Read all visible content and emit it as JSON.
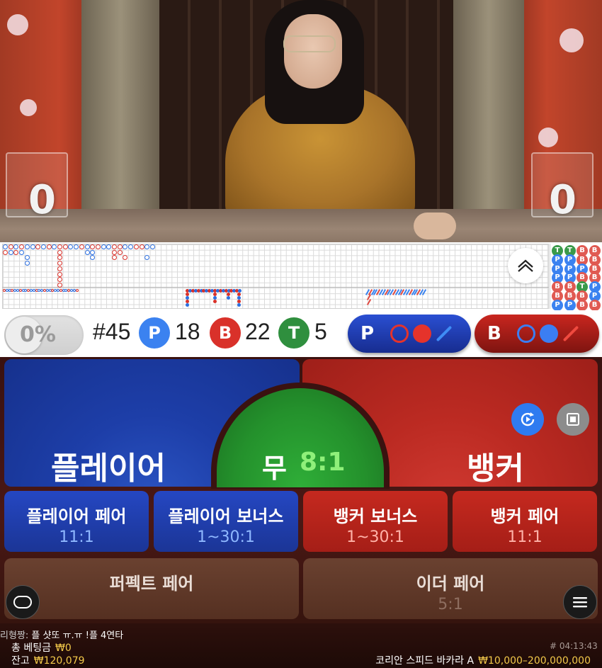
{
  "video": {
    "score_player": "0",
    "score_banker": "0"
  },
  "roadmap": {
    "expand_icon": "chevron-up-icon",
    "bead_columns": [
      [
        "T",
        "P",
        "P",
        "P",
        "B",
        "B",
        "P"
      ],
      [
        "T",
        "P",
        "P",
        "P",
        "B",
        "B",
        "P"
      ],
      [
        "B",
        "B",
        "P",
        "B",
        "T",
        "B",
        "B"
      ],
      [
        "B",
        "B",
        "B",
        "B",
        "P",
        "P",
        "B"
      ]
    ]
  },
  "stats": {
    "percent": "0%",
    "round_number": "#45",
    "player_letter": "P",
    "player_count": "18",
    "banker_letter": "B",
    "banker_count": "22",
    "tie_letter": "T",
    "tie_count": "5",
    "player_predict_label": "P",
    "banker_predict_label": "B"
  },
  "bets": {
    "player": "플레이어",
    "banker": "뱅커",
    "tie": "무",
    "tie_odds": "8:1",
    "player_pair": {
      "label": "플레이어 페어",
      "odds": "11:1"
    },
    "player_bonus": {
      "label": "플레이어 보너스",
      "odds": "1~30:1"
    },
    "banker_bonus": {
      "label": "뱅커 보너스",
      "odds": "1~30:1"
    },
    "banker_pair": {
      "label": "뱅커 페어",
      "odds": "11:1"
    },
    "perfect_pair": {
      "label": "퍼펙트 페어",
      "odds": ""
    },
    "either_pair": {
      "label": "이더 페어",
      "odds": "5:1"
    }
  },
  "controls": {
    "autoplay_icon": "refresh-play-icon",
    "stop_icon": "stop-icon",
    "chat_icon": "chat-bubble-icon",
    "menu_icon": "hamburger-menu-icon"
  },
  "footer": {
    "chat_nick": "리형짱:",
    "chat_message": "플 샷또 ㅠ.ㅠ !플 4연타",
    "total_bet_label": "총 베팅금",
    "total_bet_value": "₩0",
    "balance_label": "잔고",
    "balance_value": "₩120,079",
    "round_id": "# 04:13:43",
    "table_name": "코리안 스피드 바카라 A",
    "table_limits": "₩10,000–200,000,000"
  },
  "colors": {
    "player": "#1d3ea8",
    "banker": "#bb2a22",
    "tie": "#24912c",
    "accent_gold": "#f3c94a"
  }
}
